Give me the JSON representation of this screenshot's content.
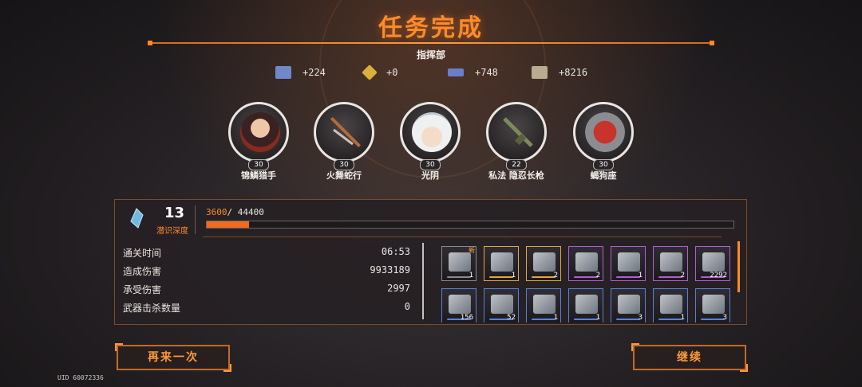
{
  "header": {
    "title": "任务完成",
    "subtitle": "指挥部"
  },
  "rewards": [
    {
      "icon": "cube-currency-icon",
      "amount": "+224",
      "color": "#6f88c8"
    },
    {
      "icon": "gem-currency-icon",
      "amount": "+0",
      "color": "#d9b03a"
    },
    {
      "icon": "drone-part-icon",
      "amount": "+748",
      "color": "#6a7fc7"
    },
    {
      "icon": "ticket-currency-icon",
      "amount": "+8216",
      "color": "#b8ab8e"
    }
  ],
  "characters": [
    {
      "name": "锦鳞猎手",
      "level": "30",
      "icon": "hunter-portrait-icon"
    },
    {
      "name": "火舞蛇行",
      "level": "30",
      "icon": "spear-weapon-icon"
    },
    {
      "name": "光阴",
      "level": "30",
      "icon": "white-hair-portrait-icon"
    },
    {
      "name": "私法 隐忍长枪",
      "level": "22",
      "icon": "rifle-weapon-icon"
    },
    {
      "name": "蝎狗座",
      "level": "30",
      "icon": "mech-scorpion-icon"
    }
  ],
  "depth": {
    "level": "13",
    "label": "潜识深度",
    "xp_current": "3600",
    "xp_total": "/ 44400",
    "progress": 0.081
  },
  "stats": [
    {
      "label": "通关时间",
      "value": "06:53"
    },
    {
      "label": "造成伤害",
      "value": "9933189"
    },
    {
      "label": "承受伤害",
      "value": "2997"
    },
    {
      "label": "武器击杀数量",
      "value": "0"
    }
  ],
  "items": [
    {
      "icon": "figure-item-icon",
      "count": "1",
      "new": "新",
      "rarity": "#8a8a8a"
    },
    {
      "icon": "rifle-item-icon",
      "count": "1",
      "new": "",
      "rarity": "#e6a63a"
    },
    {
      "icon": "chip-item-icon",
      "count": "2",
      "new": "",
      "rarity": "#e6a63a"
    },
    {
      "icon": "gun-mod-item-icon",
      "count": "2",
      "new": "",
      "rarity": "#b85ad6"
    },
    {
      "icon": "blade-item-icon",
      "count": "1",
      "new": "",
      "rarity": "#b85ad6"
    },
    {
      "icon": "case-item-icon",
      "count": "2",
      "new": "",
      "rarity": "#b85ad6"
    },
    {
      "icon": "core-item-icon",
      "count": "2292",
      "new": "",
      "rarity": "#b85ad6"
    },
    {
      "icon": "capsule-item-icon",
      "count": "156",
      "new": "",
      "rarity": "#5a7fd6"
    },
    {
      "icon": "syringe-item-icon",
      "count": "52",
      "new": "",
      "rarity": "#5a7fd6"
    },
    {
      "icon": "gun-mod-item-icon",
      "count": "1",
      "new": "",
      "rarity": "#5a7fd6"
    },
    {
      "icon": "gun-mod-item-icon",
      "count": "1",
      "new": "",
      "rarity": "#5a7fd6"
    },
    {
      "icon": "gun-mod-item-icon",
      "count": "3",
      "new": "",
      "rarity": "#5a7fd6"
    },
    {
      "icon": "gun-mod-item-icon",
      "count": "1",
      "new": "",
      "rarity": "#5a7fd6"
    },
    {
      "icon": "gun-mod-item-icon",
      "count": "3",
      "new": "",
      "rarity": "#5a7fd6"
    },
    {
      "icon": "gun-mod-item-icon",
      "count": "2",
      "new": "",
      "rarity": "#5a7fd6"
    }
  ],
  "buttons": {
    "retry": "再来一次",
    "continue": "继续"
  },
  "uid": "UID 60072336",
  "accent": "#ff8a2a"
}
